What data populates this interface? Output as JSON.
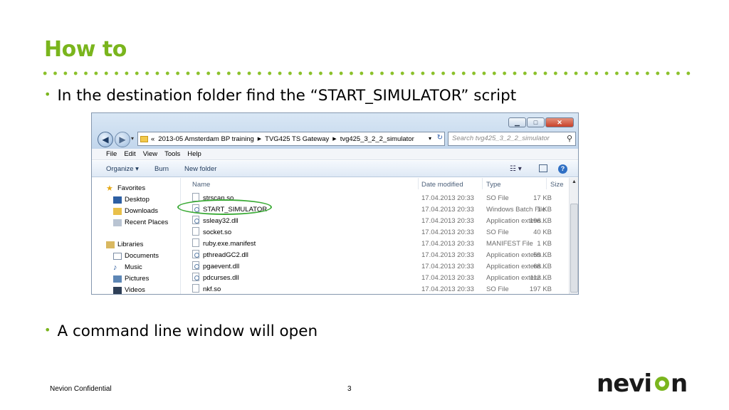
{
  "slide": {
    "title": "How to",
    "bullet1": "In the destination folder find the “START_SIMULATOR” script",
    "bullet2": "A command line window will open",
    "footer_confidential": "Nevion Confidential",
    "page_number": "3",
    "logo_text": "nevion",
    "accent_color": "#7ab51d"
  },
  "explorer": {
    "address": {
      "prefix": "«",
      "crumbs": [
        "2013-05 Amsterdam BP training",
        "TVG425 TS Gateway",
        "tvg425_3_2_2_simulator"
      ]
    },
    "search_placeholder": "Search tvg425_3_2_2_simulator",
    "menu": [
      "File",
      "Edit",
      "View",
      "Tools",
      "Help"
    ],
    "toolbar": {
      "organize": "Organize ▾",
      "burn": "Burn",
      "new_folder": "New folder"
    },
    "nav": {
      "favorites": "Favorites",
      "desktop": "Desktop",
      "downloads": "Downloads",
      "recent_places": "Recent Places",
      "libraries": "Libraries",
      "documents": "Documents",
      "music": "Music",
      "pictures": "Pictures",
      "videos": "Videos"
    },
    "columns": {
      "name": "Name",
      "date": "Date modified",
      "type": "Type",
      "size": "Size"
    },
    "files": [
      {
        "name": "strscan.so",
        "date": "17.04.2013 20:33",
        "type": "SO File",
        "size": "17 KB"
      },
      {
        "name": "START_SIMULATOR",
        "date": "17.04.2013 20:33",
        "type": "Windows Batch File",
        "size": "1 KB"
      },
      {
        "name": "ssleay32.dll",
        "date": "17.04.2013 20:33",
        "type": "Application extens...",
        "size": "196 KB"
      },
      {
        "name": "socket.so",
        "date": "17.04.2013 20:33",
        "type": "SO File",
        "size": "40 KB"
      },
      {
        "name": "ruby.exe.manifest",
        "date": "17.04.2013 20:33",
        "type": "MANIFEST File",
        "size": "1 KB"
      },
      {
        "name": "pthreadGC2.dll",
        "date": "17.04.2013 20:33",
        "type": "Application extens...",
        "size": "59 KB"
      },
      {
        "name": "pgaevent.dll",
        "date": "17.04.2013 20:33",
        "type": "Application extens...",
        "size": "68 KB"
      },
      {
        "name": "pdcurses.dll",
        "date": "17.04.2013 20:33",
        "type": "Application extens...",
        "size": "112 KB"
      },
      {
        "name": "nkf.so",
        "date": "17.04.2013 20:33",
        "type": "SO File",
        "size": "197 KB"
      }
    ]
  }
}
